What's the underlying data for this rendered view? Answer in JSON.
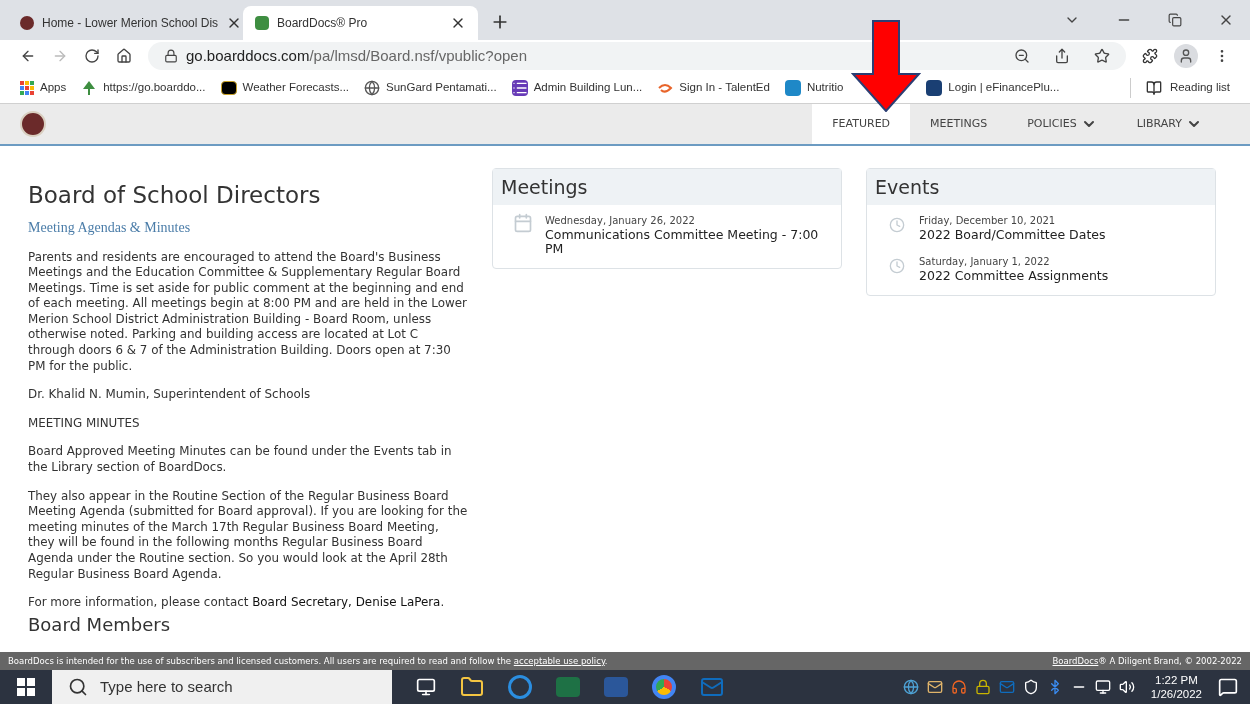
{
  "browser": {
    "tabs": [
      {
        "title": "Home - Lower Merion School Dis",
        "selected": false
      },
      {
        "title": "BoardDocs® Pro",
        "selected": true
      }
    ],
    "url_host": "go.boarddocs.com",
    "url_path": "/pa/lmsd/Board.nsf/vpublic?open",
    "bookmarks": [
      {
        "label": "Apps",
        "kind": "apps"
      },
      {
        "label": "https://go.boarddo...",
        "kind": "tree"
      },
      {
        "label": "Weather Forecasts...",
        "kind": "bb"
      },
      {
        "label": "SunGard Pentamati...",
        "kind": "globe"
      },
      {
        "label": "Admin Building Lun...",
        "kind": "list"
      },
      {
        "label": "Sign In - TalentEd",
        "kind": "swirl"
      },
      {
        "label": "Nutritio",
        "kind": "q"
      },
      {
        "label": "Login | eFinancePlu...",
        "kind": "p"
      }
    ],
    "reading_list": "Reading list"
  },
  "nav": [
    {
      "label": "FEATURED",
      "selected": true,
      "dropdown": false
    },
    {
      "label": "MEETINGS",
      "selected": false,
      "dropdown": false
    },
    {
      "label": "POLICIES",
      "selected": false,
      "dropdown": true
    },
    {
      "label": "LIBRARY",
      "selected": false,
      "dropdown": true
    }
  ],
  "intro": {
    "heading": "Board of School Directors",
    "subheading": "Meeting Agendas & Minutes",
    "paragraphs": [
      "Parents and residents are encouraged to attend the Board's Business Meetings and the Education Committee & Supplementary Regular Board Meetings. Time is set aside for public comment at the beginning and end of each meeting. All meetings begin at 8:00 PM and are held in the Lower Merion School District Administration Building - Board Room, unless otherwise noted. Parking and building access are located at Lot C through doors 6 & 7 of the Administration Building. Doors open at 7:30 PM for the public.",
      "Dr. Khalid N. Mumin, Superintendent of Schools",
      "MEETING MINUTES",
      "Board Approved Meeting Minutes can be found under the Events tab in the Library section of BoardDocs.",
      "They also appear in the Routine Section of the Regular Business Board Meeting Agenda (submitted for Board approval). If you are looking for the meeting minutes of the March 17th Regular Business Board Meeting, they will be found in the following months Regular Business Board Agenda under the Routine section. So you would look at the April 28th Regular Business Board Agenda."
    ],
    "contact": {
      "text": "For more information, please contact",
      "link": "Board Secretary, Denise LaPera",
      "end": "."
    },
    "next_heading": "Board Members"
  },
  "meetings": {
    "title": "Meetings",
    "items": [
      {
        "date": "Wednesday, January 26, 2022",
        "title": "Communications Committee Meeting - 7:00 PM"
      }
    ]
  },
  "events": {
    "title": "Events",
    "items": [
      {
        "date": "Friday, December 10, 2021",
        "title": "2022 Board/Committee Dates"
      },
      {
        "date": "Saturday, January 1, 2022",
        "title": "2022 Committee Assignments"
      }
    ]
  },
  "footer": {
    "notice": "BoardDocs is intended for the use of subscribers and licensed customers. All users are required to read and follow the",
    "notice_link": "acceptable use policy",
    "notice_end": ".",
    "brand_link": "BoardDocs",
    "brand_text": "® A Diligent Brand, © 2002-2022"
  },
  "taskbar": {
    "search_placeholder": "Type here to search",
    "time": "1:22 PM",
    "date": "1/26/2022"
  }
}
